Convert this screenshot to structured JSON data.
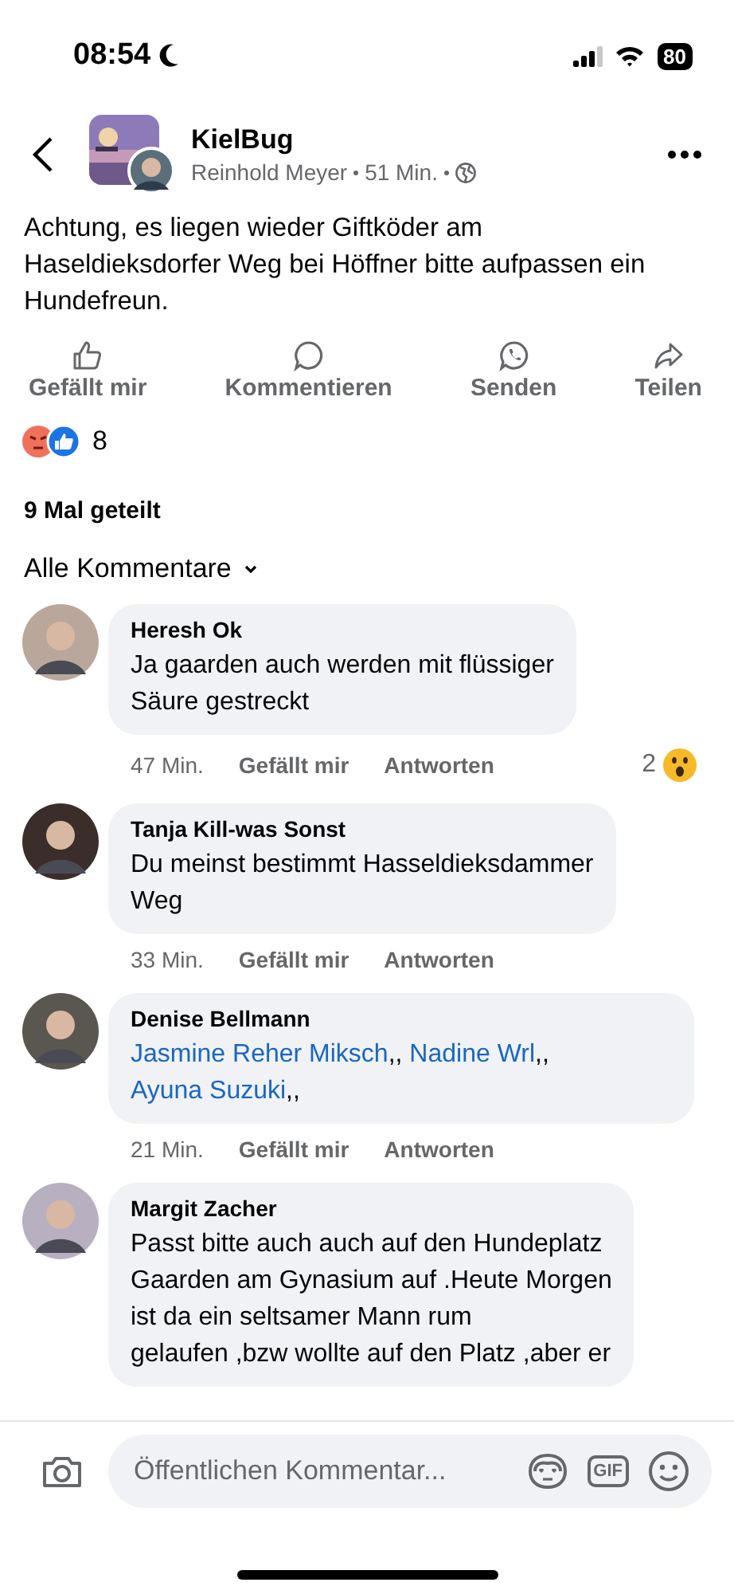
{
  "status_bar": {
    "time": "08:54",
    "battery": "80"
  },
  "post": {
    "page_name": "KielBug",
    "author": "Reinhold Meyer",
    "time": "51 Min.",
    "text": "Achtung, es liegen wieder Giftköder am\nHaseldieksdorfer Weg bei Höffner bitte aufpassen ein Hundefreun."
  },
  "actions": [
    {
      "label": "Gefällt mir",
      "kind": "like"
    },
    {
      "label": "Kommentieren",
      "kind": "comment"
    },
    {
      "label": "Senden",
      "kind": "send"
    },
    {
      "label": "Teilen",
      "kind": "share"
    }
  ],
  "reactions": {
    "count": "8"
  },
  "shares": "9 Mal geteilt",
  "comment_filter": "Alle Kommentare",
  "comments": [
    {
      "author": "Heresh Ok",
      "segments": [
        {
          "kind": "plain",
          "text": "Ja gaarden auch werden mit flüssiger\nSäure gestreckt"
        }
      ],
      "time": "47 Min.",
      "like": "Gefällt mir",
      "reply": "Antworten",
      "reaction_count": "2"
    },
    {
      "author": "Tanja Kill-was Sonst",
      "segments": [
        {
          "kind": "plain",
          "text": "Du meinst bestimmt Hasseldieksdammer\nWeg"
        }
      ],
      "time": "33 Min.",
      "like": "Gefällt mir",
      "reply": "Antworten"
    },
    {
      "author": "Denise Bellmann",
      "segments": [
        {
          "kind": "mention",
          "text": "Jasmine Reher Miksch"
        },
        {
          "kind": "plain",
          "text": ",, "
        },
        {
          "kind": "mention",
          "text": "Nadine Wrl"
        },
        {
          "kind": "plain",
          "text": ",, "
        },
        {
          "kind": "mention",
          "text": "Ayuna Suzuki"
        },
        {
          "kind": "plain",
          "text": ",,"
        }
      ],
      "time": "21 Min.",
      "like": "Gefällt mir",
      "reply": "Antworten"
    },
    {
      "author": "Margit Zacher",
      "segments": [
        {
          "kind": "plain",
          "text": "Passt bitte auch auch auf den Hundeplatz\nGaarden am Gynasium auf .Heute Morgen\nist da ein seltsamer Mann rum\ngelaufen ,bzw wollte auf den Platz ,aber er"
        }
      ]
    }
  ],
  "composer": {
    "placeholder": "Öffentlichen Kommentar...",
    "gif": "GIF"
  }
}
